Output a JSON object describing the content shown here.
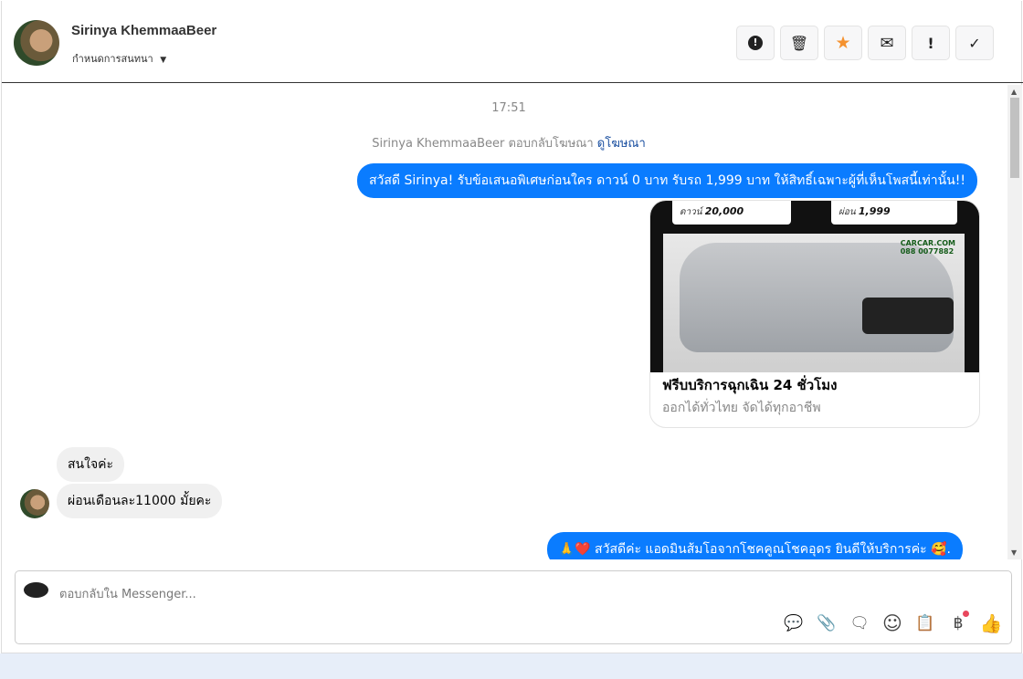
{
  "header": {
    "name": "Sirinya KhemmaaBeer",
    "assign_label": "กำหนดการสนทนา",
    "actions": [
      {
        "icon": "alert-circle-icon",
        "glyph": "⬤"
      },
      {
        "icon": "trash-icon",
        "glyph": "🗑"
      },
      {
        "icon": "star-icon",
        "glyph": "★"
      },
      {
        "icon": "envelope-icon",
        "glyph": "✉"
      },
      {
        "icon": "exclamation-icon",
        "glyph": "!"
      },
      {
        "icon": "check-icon",
        "glyph": "✓"
      }
    ]
  },
  "thread": {
    "time": "17:51",
    "system": {
      "text": "Sirinya KhemmaaBeer ตอบกลับโฆษณา",
      "link": "ดูโฆษณา"
    },
    "msg1": "สวัสดี Sirinya! รับข้อเสนอพิเศษก่อนใคร ดาวน์ 0 บาท รับรถ 1,999 บาท ให้สิทธิ์เฉพาะผู้ที่เห็นโพสนี้เท่านั้น!!",
    "card": {
      "price1_label": "ดาวน์",
      "price1": "20,000",
      "price2_label": "ผ่อน",
      "price2": "1,999",
      "logo": "CARCAR.COM",
      "phone": "088 0077882",
      "title": "ฟรีบบริการฉุกเฉิน 24 ชั่วโมง",
      "subtitle": "ออกได้ทั่วไทย จัดได้ทุกอาชีพ"
    },
    "in1": "สนใจค่ะ",
    "in2": "ผ่อนเดือนละ11000 มั้ยคะ",
    "msg2": "🙏❤️ สวัสดีค่ะ แอดมินส้มโอจากโชคคูณโชคอุดร ยินดีให้บริการค่ะ 🥰."
  },
  "composer": {
    "placeholder": "ตอบกลับใน Messenger...",
    "tools": [
      {
        "icon": "saved-reply-icon",
        "glyph": "💬"
      },
      {
        "icon": "attachment-icon",
        "glyph": "📎"
      },
      {
        "icon": "chat-dots-icon",
        "glyph": "🗨"
      },
      {
        "icon": "emoji-icon",
        "glyph": "☺"
      },
      {
        "icon": "notes-icon",
        "glyph": "📋"
      },
      {
        "icon": "baht-icon",
        "glyph": "฿"
      },
      {
        "icon": "thumbs-up-icon",
        "glyph": "👍"
      }
    ]
  },
  "colors": {
    "accent": "#0a7cff",
    "star": "#f5922f"
  }
}
